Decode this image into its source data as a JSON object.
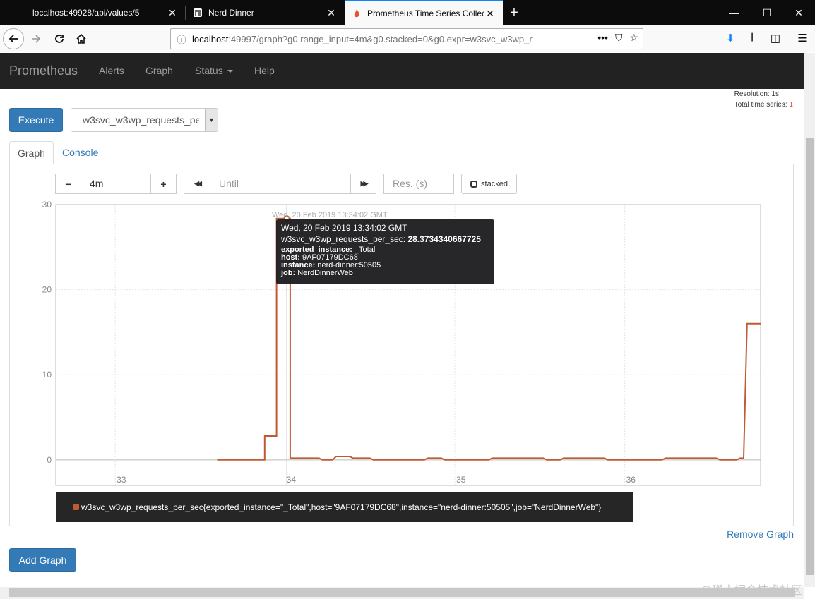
{
  "browser": {
    "tabs": [
      {
        "title": "localhost:49928/api/values/5",
        "close": "✕"
      },
      {
        "title": "Nerd Dinner",
        "close": "✕"
      },
      {
        "title": "Prometheus Time Series Collec",
        "close": "✕"
      }
    ],
    "new_tab": "+",
    "window": {
      "minimize": "—",
      "maximize": "☐",
      "close": "✕"
    },
    "url_host": "localhost",
    "url_rest": ":49997/graph?g0.range_input=4m&g0.stacked=0&g0.expr=w3svc_w3wp_r",
    "url_info": "ⓘ",
    "url_actions": {
      "more": "•••",
      "pocket": "⛉",
      "bookmark": "☆"
    },
    "tools": {
      "download": "⬇",
      "library": "𝄃",
      "sidebar": "◫",
      "menu": "☰"
    }
  },
  "prom_nav": {
    "brand": "Prometheus",
    "items": [
      "Alerts",
      "Graph",
      "Status",
      "Help"
    ]
  },
  "resolution": {
    "label": "Resolution: 1s",
    "total_label": "Total time series: ",
    "total_count": "1"
  },
  "execute_label": "Execute",
  "expression_value": "w3svc_w3wp_requests_per_sec",
  "expression_dd": "▼",
  "tabs": {
    "graph": "Graph",
    "console": "Console"
  },
  "controls": {
    "minus": "−",
    "range": "4m",
    "plus": "+",
    "back": "◀◀",
    "until_placeholder": "Until",
    "forward": "▶▶",
    "res_placeholder": "Res. (s)",
    "stacked": "stacked"
  },
  "chart_data": {
    "type": "line",
    "y_ticks": [
      "30",
      "20",
      "10",
      "0"
    ],
    "x_ticks": [
      "33",
      "34",
      "35",
      "36"
    ],
    "ylim": [
      -3,
      30
    ],
    "xlim": [
      32.65,
      36.8
    ],
    "series": [
      {
        "name": "w3svc_w3wp_requests_per_sec",
        "color": "#c05a35",
        "x": [
          33.6,
          33.88,
          33.88,
          33.95,
          33.95,
          34.03,
          34.03,
          34.05,
          34.05,
          34.2,
          34.22,
          34.28,
          34.3,
          34.38,
          34.4,
          34.5,
          34.52,
          34.82,
          34.84,
          34.92,
          34.94,
          35.2,
          35.22,
          35.52,
          35.54,
          35.62,
          35.64,
          35.88,
          35.9,
          36.22,
          36.24,
          36.54,
          36.56,
          36.66,
          36.68,
          36.7,
          36.72,
          36.8
        ],
        "y": [
          0,
          0,
          2.8,
          2.8,
          28.37,
          28.37,
          0.2,
          0.2,
          0.2,
          0.2,
          0,
          0,
          0.4,
          0.4,
          0.2,
          0.2,
          0,
          0,
          0.2,
          0.2,
          0,
          0,
          0.2,
          0.2,
          0,
          0,
          0.2,
          0.2,
          0,
          0,
          0.2,
          0.2,
          0,
          0,
          0.2,
          0.2,
          16,
          16
        ]
      }
    ],
    "hover_point": {
      "x": 34.01,
      "y": 28.37
    }
  },
  "hover_label": "Wed, 20 Feb 2019 13:34:02 GMT",
  "tooltip": {
    "date": "Wed, 20 Feb 2019 13:34:02 GMT",
    "series_name": "w3svc_w3wp_requests_per_sec: ",
    "series_value": "28.3734340667725",
    "labels": [
      {
        "k": "exported_instance:",
        "v": " _Total"
      },
      {
        "k": "host:",
        "v": " 9AF07179DC68"
      },
      {
        "k": "instance:",
        "v": " nerd-dinner:50505"
      },
      {
        "k": "job:",
        "v": " NerdDinnerWeb"
      }
    ]
  },
  "legend_text": "w3svc_w3wp_requests_per_sec{exported_instance=\"_Total\",host=\"9AF07179DC68\",instance=\"nerd-dinner:50505\",job=\"NerdDinnerWeb\"}",
  "remove_graph": "Remove Graph",
  "add_graph": "Add Graph",
  "watermark": "@稀土掘金技术社区"
}
